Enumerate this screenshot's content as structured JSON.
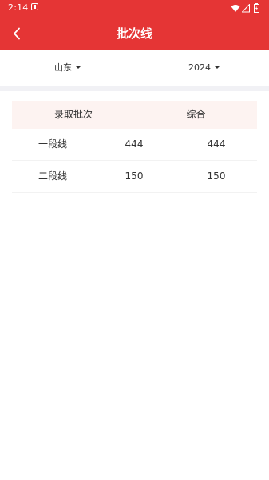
{
  "status_bar": {
    "time": "2:14",
    "icons": [
      "notification-icon",
      "wifi-icon",
      "signal-icon",
      "battery-icon"
    ]
  },
  "app_bar": {
    "title": "批次线",
    "back_icon": "chevron-left-icon"
  },
  "filters": {
    "province": "山东",
    "year": "2024"
  },
  "table": {
    "headers": [
      "录取批次",
      "综合"
    ],
    "rows": [
      [
        "一段线",
        "444",
        "444"
      ],
      [
        "二段线",
        "150",
        "150"
      ]
    ]
  },
  "colors": {
    "primary": "#e53535",
    "header_bg": "#fdf3f1",
    "band": "#f1f1f5"
  }
}
